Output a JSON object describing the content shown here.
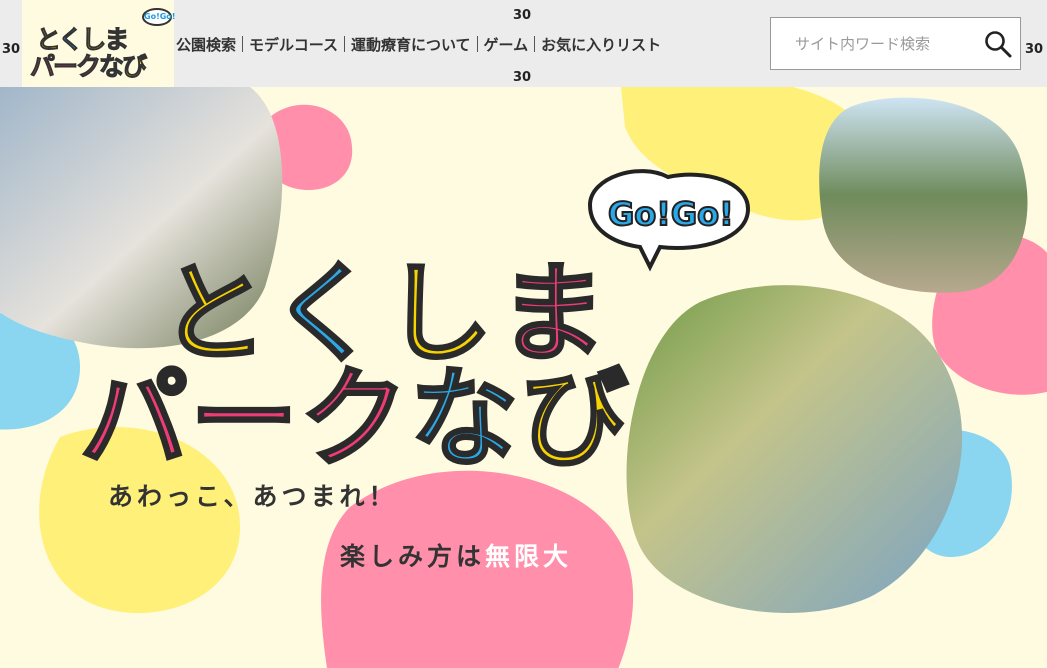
{
  "spacing_marks": [
    "30",
    "30",
    "30",
    "30"
  ],
  "logo": {
    "bubble": "Go!Go!",
    "line1": [
      "と",
      "く",
      "し",
      "ま"
    ],
    "line2": [
      "パ",
      "ー",
      "ク",
      "な",
      "び"
    ]
  },
  "nav": {
    "items": [
      "公園検索",
      "モデルコース",
      "運動療育について",
      "ゲーム",
      "お気に入りリスト"
    ]
  },
  "search": {
    "placeholder": "サイト内ワード検索"
  },
  "hero": {
    "bubble": "Go!Go!",
    "title_line1": [
      "と",
      "く",
      "し",
      "ま"
    ],
    "title_line2": [
      "パ",
      "ー",
      "ク",
      "な",
      "び"
    ],
    "catch1": "あわっこ、あつまれ！",
    "catch2_prefix": "楽しみ方は",
    "catch2_accent": "無限大"
  },
  "colors": {
    "bg": "#fffbe0",
    "yellow": "#f7d300",
    "blue": "#2aa8e8",
    "pink": "#ee3c77",
    "blob_pink": "#ff8faa",
    "blob_yellow": "#fff07a",
    "blob_blue": "#8ad5f0"
  },
  "icons": {
    "search": "magnifier-icon"
  }
}
